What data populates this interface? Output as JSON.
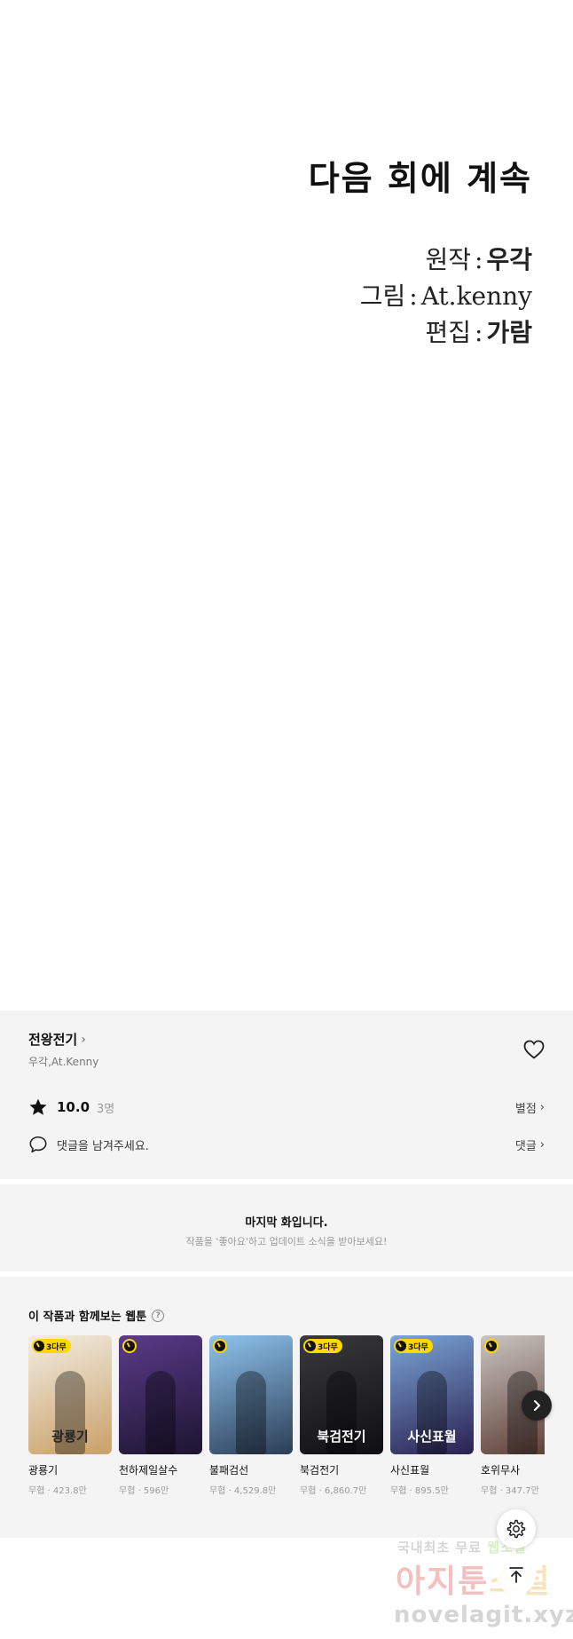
{
  "comic": {
    "continue_text": "다음 회에 계속",
    "credits": [
      {
        "role": "원작",
        "name": "우각"
      },
      {
        "role": "그림",
        "name": "At.kenny"
      },
      {
        "role": "편집",
        "name": "가람"
      }
    ],
    "separator": ":"
  },
  "info": {
    "series_title": "전왕전기",
    "authors": "우각,At.Kenny",
    "rating_score": "10.0",
    "rating_count": "3명",
    "rating_link": "별점",
    "comment_prompt": "댓글을 남겨주세요.",
    "comment_link": "댓글",
    "icons": {
      "favorite": "heart-icon",
      "rating": "star-icon",
      "comment": "speech-bubble-icon"
    }
  },
  "last_episode": {
    "title": "마지막 화입니다.",
    "subtitle": "작품을 '좋아요'하고 업데이트 소식을 받아보세요!"
  },
  "recommendations": {
    "heading": "이 작품과 함께보는 웹툰",
    "badge_label": "3다무",
    "items": [
      {
        "title": "광룡기",
        "meta": "무협 · 423.8만",
        "badge": "3다무",
        "cover_text": "광룡기",
        "colors": [
          "#f2ede2",
          "#c9a068"
        ]
      },
      {
        "title": "천하제일살수",
        "meta": "무협 · 596만",
        "badge": "",
        "cover_text": "",
        "colors": [
          "#5b3b8a",
          "#1c1530"
        ]
      },
      {
        "title": "불패검선",
        "meta": "무협 · 4,529.8만",
        "badge": "",
        "cover_text": "",
        "colors": [
          "#8fc4ee",
          "#2b3d55"
        ]
      },
      {
        "title": "북검전기",
        "meta": "무협 · 6,860.7만",
        "badge": "3다무",
        "cover_text": "북검전기",
        "colors": [
          "#3a3a3e",
          "#0f0f12"
        ]
      },
      {
        "title": "사신표월",
        "meta": "무협 · 895.5만",
        "badge": "3다무",
        "cover_text": "사신표월",
        "colors": [
          "#7aa6d8",
          "#2a2050"
        ]
      },
      {
        "title": "호위무사",
        "meta": "무협 · 347.7만",
        "badge": "",
        "cover_text": "",
        "colors": [
          "#c9c4c0",
          "#5a3a32"
        ]
      }
    ]
  },
  "floating": {
    "settings_icon": "gear-icon",
    "scroll_top_icon": "arrow-up-icon"
  },
  "watermark": {
    "line1_a": "국내최초 무료",
    "line1_b": "웹소설",
    "line2_a": "아지툰",
    "line2_b": "소설",
    "line3": "novelagit.xyz"
  }
}
